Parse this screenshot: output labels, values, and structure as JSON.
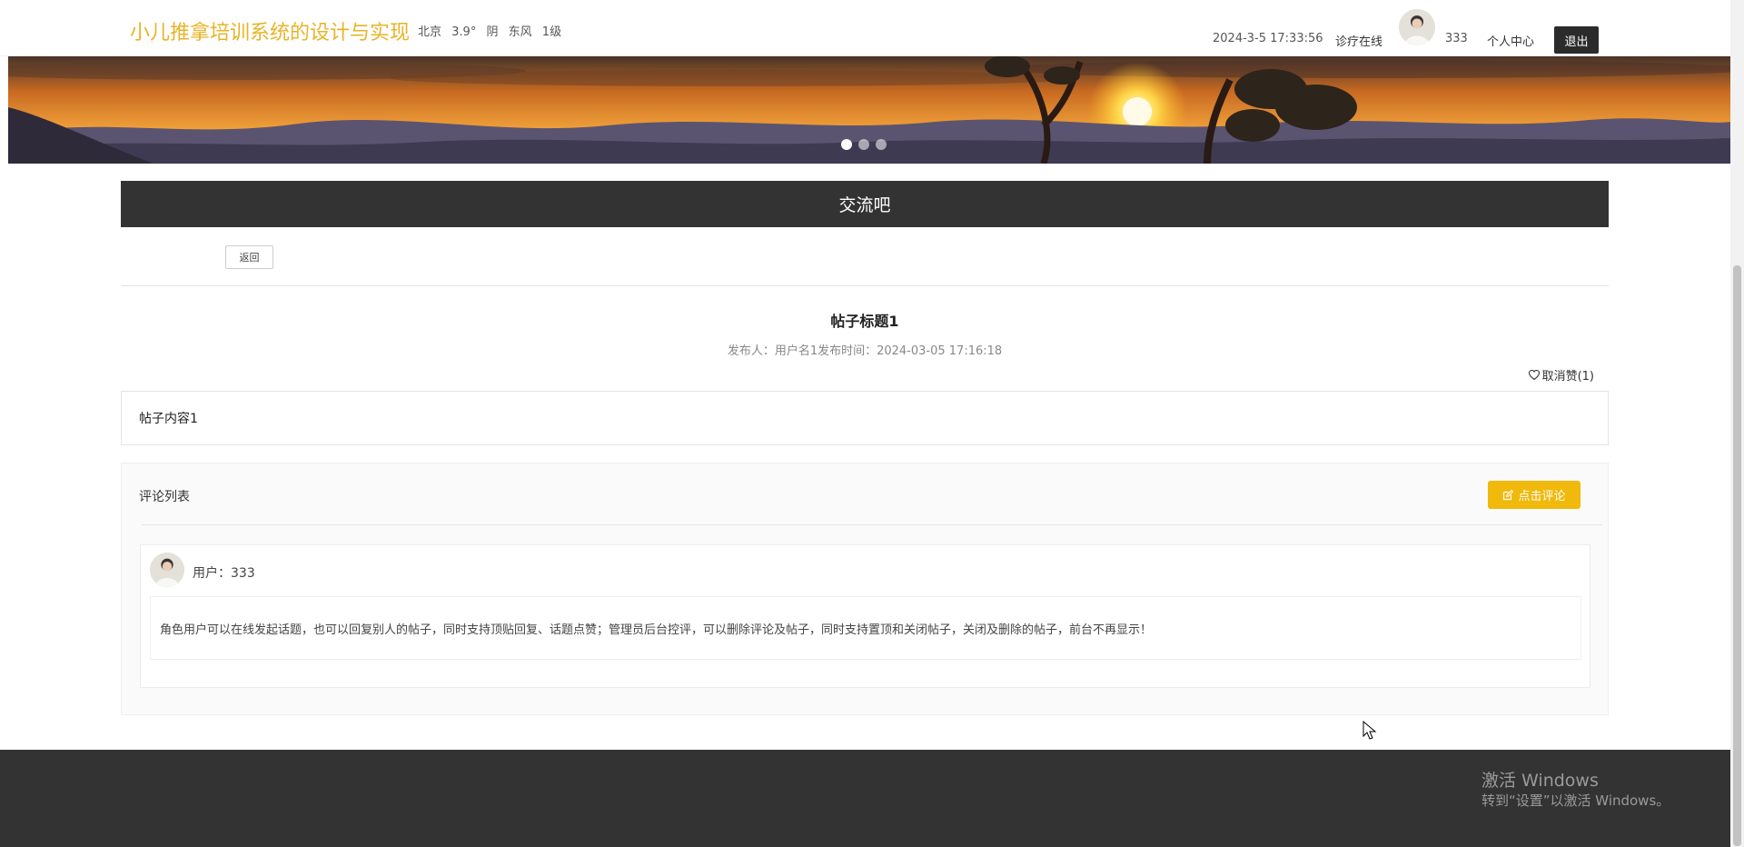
{
  "header": {
    "brand": "小儿推拿培训系统的设计与实现",
    "weather": {
      "city": "北京",
      "temp": "3.9°",
      "sky": "阴",
      "wind": "东风",
      "level": "1级"
    },
    "datetime": "2024-3-5 17:33:56",
    "site_link": "诊疗在线",
    "username": "333",
    "user_center": "个人中心",
    "logout": "退出"
  },
  "banner": {
    "active_slide": 0,
    "slides": 3
  },
  "section": {
    "title": "交流吧"
  },
  "actions": {
    "back": "返回"
  },
  "post": {
    "title": "帖子标题1",
    "meta": "发布人：用户名1发布时间：2024-03-05 17:16:18",
    "like_label": "取消赞(1)",
    "content": "帖子内容1"
  },
  "comments": {
    "header": "评论列表",
    "add_button": "点击评论",
    "items": [
      {
        "user": "用户：333",
        "text": "角色用户可以在线发起话题，也可以回复别人的帖子，同时支持顶贴回复、话题点赞；管理员后台控评，可以删除评论及帖子，同时支持置顶和关闭帖子，关闭及删除的帖子，前台不再显示！"
      }
    ]
  },
  "watermark": {
    "line1": "激活 Windows",
    "line2": "转到“设置”以激活 Windows。"
  },
  "colors": {
    "brand": "#e8b326",
    "accent": "#f0b90b",
    "dark": "#333333"
  }
}
